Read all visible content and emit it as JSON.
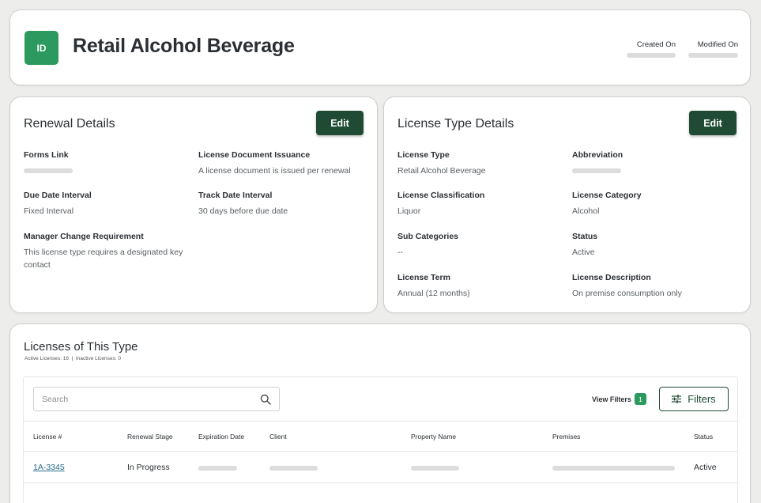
{
  "header": {
    "badge": "ID",
    "title": "Retail Alcohol Beverage",
    "created_label": "Created On",
    "modified_label": "Modified On"
  },
  "renewal": {
    "title": "Renewal Details",
    "edit_label": "Edit",
    "fields": [
      {
        "label": "Forms Link",
        "value": ""
      },
      {
        "label": "License Document Issuance",
        "value": "A license document is issued per renewal"
      },
      {
        "label": "Due Date Interval",
        "value": "Fixed Interval"
      },
      {
        "label": "Track Date Interval",
        "value": "30 days before due date"
      },
      {
        "label": "Manager Change Requirement",
        "value": "This license type requires a designated key contact"
      }
    ]
  },
  "license_type": {
    "title": "License Type Details",
    "edit_label": "Edit",
    "fields": [
      {
        "label": "License Type",
        "value": "Retail Alcohol Beverage"
      },
      {
        "label": "Abbreviation",
        "value": ""
      },
      {
        "label": "License Classification",
        "value": "Liquor"
      },
      {
        "label": "License Category",
        "value": "Alcohol"
      },
      {
        "label": "Sub Categories",
        "value": "--"
      },
      {
        "label": "Status",
        "value": "Active"
      },
      {
        "label": "License Term",
        "value": "Annual (12 months)"
      },
      {
        "label": "License Description",
        "value": "On premise consumption only"
      }
    ]
  },
  "licenses": {
    "title": "Licenses of This Type",
    "subtitle": "Active Licenses: 16  |  Inactive Licenses: 0",
    "search_placeholder": "Search",
    "view_filters_label": "View Filters",
    "view_filters_count": "1",
    "filters_label": "Filters",
    "columns": [
      "License #",
      "Renewal Stage",
      "Expiration Date",
      "Client",
      "Property Name",
      "Premises",
      "Status"
    ],
    "rows": [
      {
        "license": "1A-3345",
        "stage": "In Progress",
        "status": "Active"
      }
    ]
  },
  "colors": {
    "accent_green": "#2c9a5e",
    "dark_green": "#1f4a33",
    "link_blue": "#2a6e8f"
  }
}
